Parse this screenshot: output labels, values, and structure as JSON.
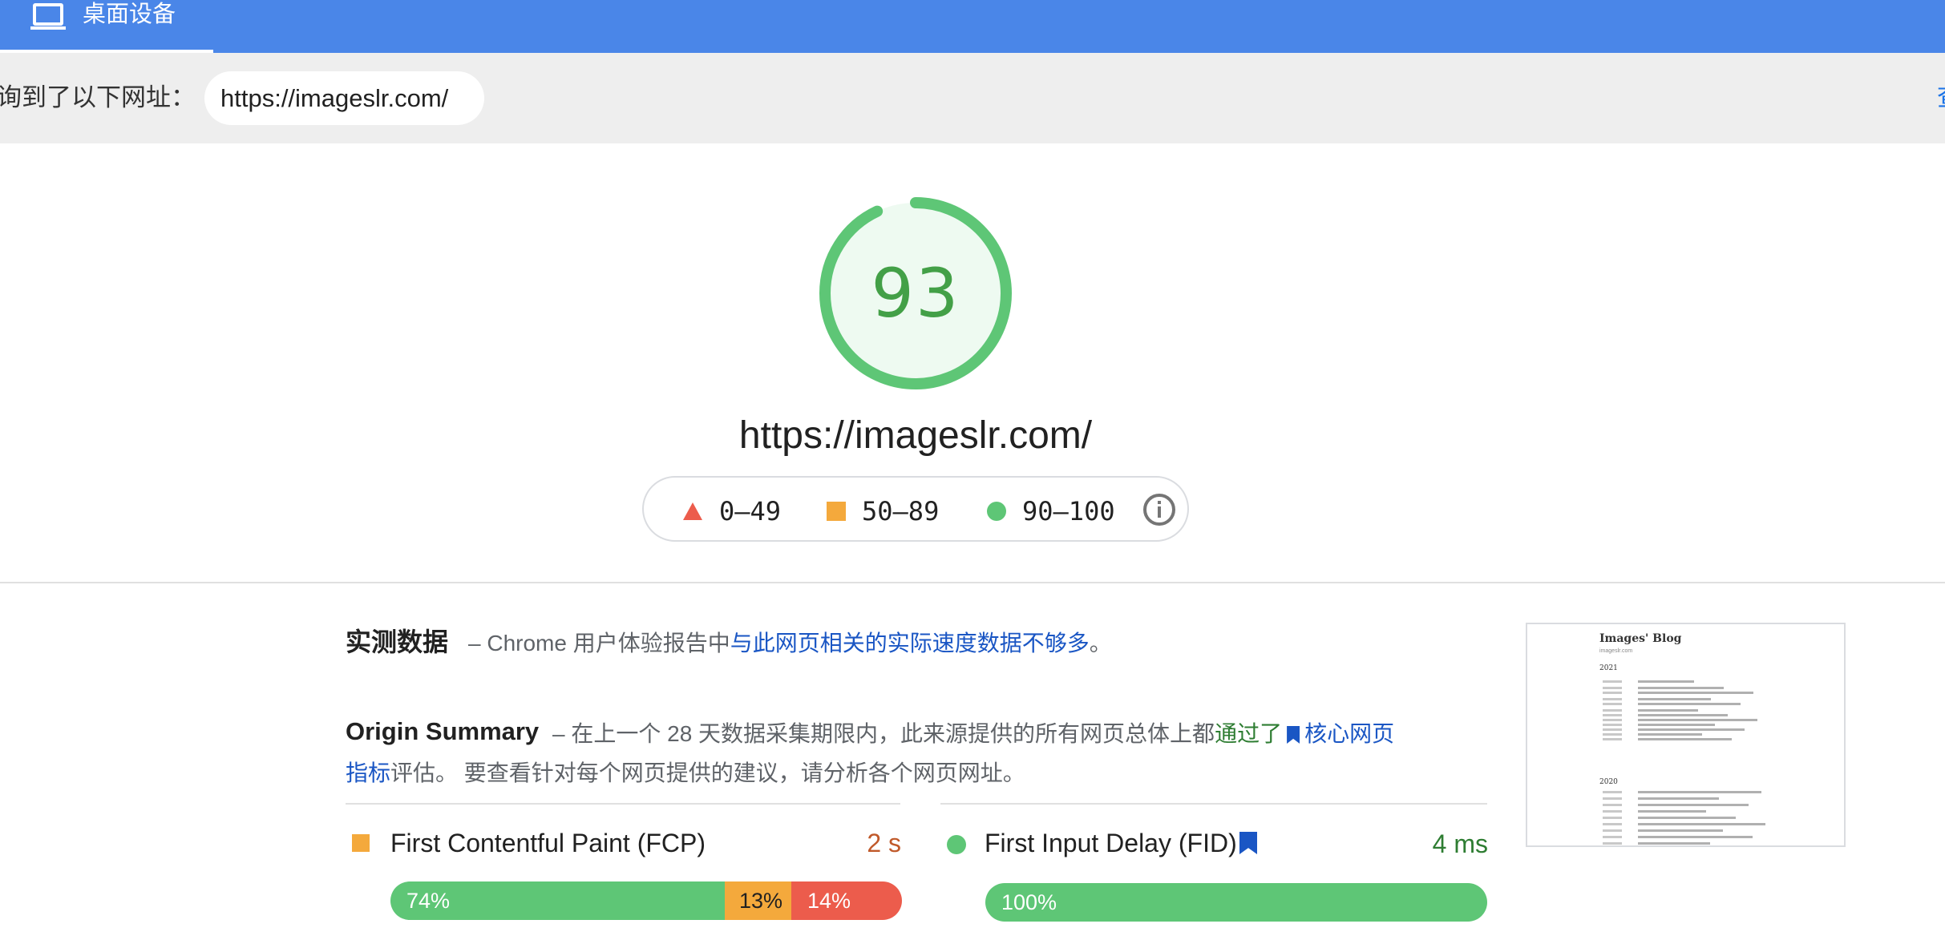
{
  "tab": {
    "label": "桌面设备",
    "icon": "laptop-icon"
  },
  "url_row": {
    "prefix": "询到了以下网址：",
    "url": "https://imageslr.com/",
    "edge_link": "查"
  },
  "score": {
    "value": "93",
    "fraction": 0.93,
    "color": "#5ec676"
  },
  "page_url": "https://imageslr.com/",
  "legend": {
    "fail": "0–49",
    "average": "50–89",
    "pass": "90–100",
    "info_icon": "info-icon"
  },
  "field_data": {
    "title": "实测数据",
    "desc_prefix": "– Chrome 用户体验报告中",
    "desc_link": "与此网页相关的实际速度数据不够多",
    "desc_suffix": "。"
  },
  "origin_summary": {
    "title": "Origin Summary",
    "text_prefix": "– 在上一个 28 天数据采集期限内，此来源提供的所有网页总体上都",
    "pass_text": "通过了",
    "link_text": "核心网页指标",
    "text_suffix": "评估。 要查看针对每个网页提供的建议，请分析各个网页网址。"
  },
  "metrics": {
    "fcp": {
      "name": "First Contentful Paint (FCP)",
      "value": "2 s",
      "distribution": {
        "good": "74%",
        "average": "13%",
        "poor": "14%"
      }
    },
    "fid": {
      "name": "First Input Delay (FID)",
      "value": "4 ms",
      "distribution": {
        "good": "100%"
      }
    }
  },
  "thumbnail": {
    "title": "Images' Blog",
    "subtitle": "imageslr.com",
    "years": [
      "2021",
      "2020"
    ]
  },
  "colors": {
    "brand_blue": "#4a86e8",
    "good": "#5ec676",
    "average": "#f4a93c",
    "poor": "#ec5c4c"
  }
}
